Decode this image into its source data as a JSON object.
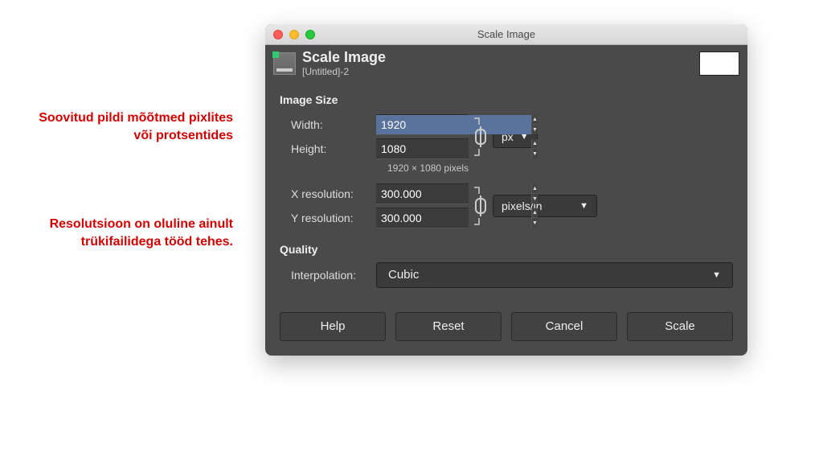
{
  "annotations": {
    "size": "Soovitud pildi mõõtmed pixlites või protsentides",
    "resolution": "Resolutsioon on oluline ainult trükifailidega tööd tehes."
  },
  "window": {
    "title": "Scale Image",
    "header_title": "Scale Image",
    "header_subtitle": "[Untitled]-2"
  },
  "sections": {
    "image_size": "Image Size",
    "quality": "Quality"
  },
  "fields": {
    "width_label": "Width:",
    "width_value": "1920",
    "height_label": "Height:",
    "height_value": "1080",
    "dimensions_text": "1920 × 1080 pixels",
    "xres_label": "X resolution:",
    "xres_value": "300.000",
    "yres_label": "Y resolution:",
    "yres_value": "300.000",
    "interp_label": "Interpolation:",
    "interp_value": "Cubic",
    "size_unit": "px",
    "res_unit": "pixels/in"
  },
  "buttons": {
    "help": "Help",
    "reset": "Reset",
    "cancel": "Cancel",
    "scale": "Scale"
  }
}
